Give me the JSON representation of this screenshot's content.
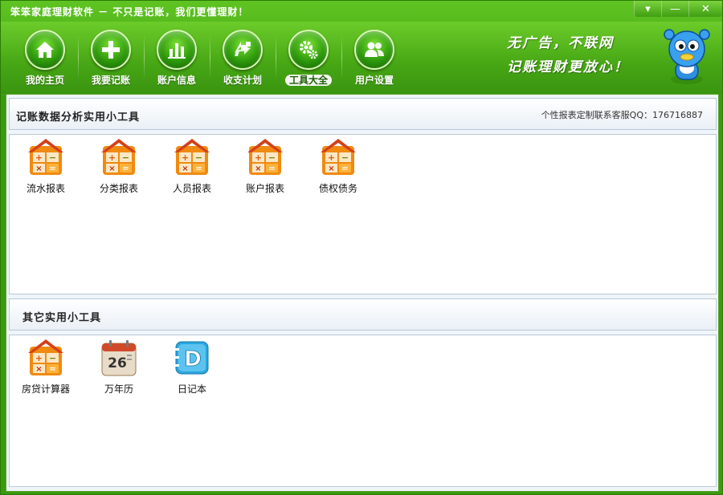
{
  "window": {
    "title": "笨笨家庭理财软件  － 不只是记账，我们更懂理财！",
    "controls": {
      "menu": "▾",
      "minimize": "—",
      "close": "✕"
    }
  },
  "nav": {
    "items": [
      {
        "label": "我的主页",
        "icon": "home-icon"
      },
      {
        "label": "我要记账",
        "icon": "plus-icon"
      },
      {
        "label": "账户信息",
        "icon": "bar-chart-icon"
      },
      {
        "label": "收支计划",
        "icon": "arrows-icon"
      },
      {
        "label": "工具大全",
        "icon": "gears-icon",
        "active": true
      },
      {
        "label": "用户设置",
        "icon": "users-icon"
      }
    ]
  },
  "slogan": {
    "line1": "无广告，不联网",
    "line2": "记账理财更放心！"
  },
  "analysis": {
    "title": "记账数据分析实用小工具",
    "contact": "个性报表定制联系客服QQ：176716887",
    "tools": [
      {
        "label": "流水报表",
        "icon": "calculator-icon"
      },
      {
        "label": "分类报表",
        "icon": "calculator-icon"
      },
      {
        "label": "人员报表",
        "icon": "calculator-icon"
      },
      {
        "label": "账户报表",
        "icon": "calculator-icon"
      },
      {
        "label": "债权债务",
        "icon": "calculator-icon"
      }
    ]
  },
  "other": {
    "title": "其它实用小工具",
    "tools": [
      {
        "label": "房贷计算器",
        "icon": "calculator-icon"
      },
      {
        "label": "万年历",
        "icon": "calendar-icon",
        "calendar_day": "26"
      },
      {
        "label": "日记本",
        "icon": "diary-icon",
        "diary_letter": "D"
      }
    ]
  },
  "colors": {
    "brand_green": "#3a9a10",
    "icon_orange": "#f08a10",
    "icon_red": "#d4401a",
    "diary_blue": "#2aa7e0"
  }
}
